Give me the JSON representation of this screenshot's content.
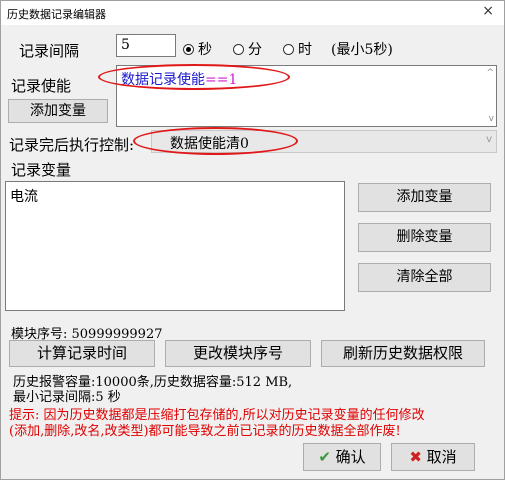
{
  "window": {
    "title": "历史数据记录编辑器",
    "close": "×"
  },
  "interval": {
    "label": "记录间隔",
    "value": "5",
    "units": [
      "秒",
      "分",
      "时"
    ],
    "selected_unit": "秒",
    "hint": "(最小5秒)"
  },
  "enable": {
    "label": "记录使能",
    "add_button": "添加变量",
    "expr_text": "数据记录使能",
    "expr_op": "==1"
  },
  "post_control": {
    "label": "记录完后执行控制:",
    "value": "数据使能清0"
  },
  "variables": {
    "label": "记录变量",
    "items": [
      "电流"
    ],
    "add_button": "添加变量",
    "delete_button": "删除变量",
    "clear_button": "清除全部"
  },
  "module": {
    "serial_label": "模块序号: 50999999927",
    "calc_button": "计算记录时间",
    "change_button": "更改模块序号",
    "refresh_button": "刷新历史数据权限"
  },
  "capacity": {
    "line1": "历史报警容量:10000条,历史数据容量:512 MB,",
    "line2": "最小记录间隔:5 秒"
  },
  "warning": {
    "line1": "提示: 因为历史数据都是压缩打包存储的,所以对历史记录变量的任何修改",
    "line2": "(添加,删除,改名,改类型)都可能导致之前已记录的历史数据全部作废!"
  },
  "footer": {
    "ok": "确认",
    "cancel": "取消"
  },
  "colors": {
    "warning_red": "#e00000",
    "annotation_red": "#e01818",
    "expr_blue": "#1a1ad0",
    "expr_magenta": "#d020d0"
  }
}
